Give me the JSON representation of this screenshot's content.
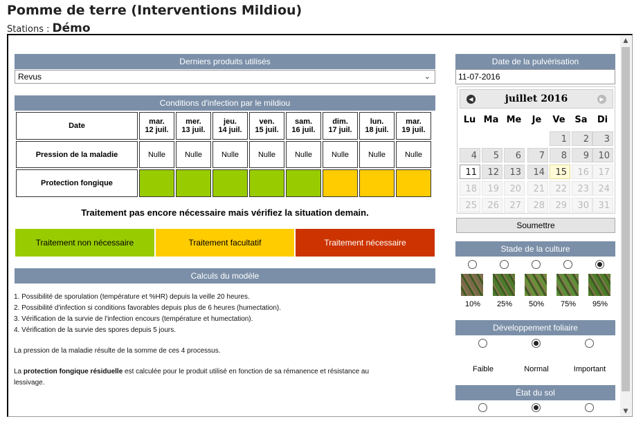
{
  "page": {
    "title": "Pomme de terre (Interventions Mildiou)",
    "stations_label": "Stations :",
    "station_value": "Démo"
  },
  "products": {
    "header": "Derniers produits utilisés",
    "selected": "Revus"
  },
  "conditions": {
    "header": "Conditions d'infection par le mildiou",
    "row_labels": {
      "date": "Date",
      "pressure": "Pression de la maladie",
      "protection": "Protection fongique"
    },
    "days": [
      {
        "dow": "mar.",
        "date": "12 juil.",
        "pressure": "Nulle",
        "protection": "green"
      },
      {
        "dow": "mer.",
        "date": "13 juil.",
        "pressure": "Nulle",
        "protection": "green"
      },
      {
        "dow": "jeu.",
        "date": "14 juil.",
        "pressure": "Nulle",
        "protection": "green"
      },
      {
        "dow": "ven.",
        "date": "15 juil.",
        "pressure": "Nulle",
        "protection": "green"
      },
      {
        "dow": "sam.",
        "date": "16 juil.",
        "pressure": "Nulle",
        "protection": "green"
      },
      {
        "dow": "dim.",
        "date": "17 juil.",
        "pressure": "Nulle",
        "protection": "yellow"
      },
      {
        "dow": "lun.",
        "date": "18 juil.",
        "pressure": "Nulle",
        "protection": "yellow"
      },
      {
        "dow": "mar.",
        "date": "19 juil.",
        "pressure": "Nulle",
        "protection": "yellow"
      }
    ]
  },
  "message": "Traitement pas encore nécessaire mais vérifiez la situation demain.",
  "legend": {
    "green": {
      "label": "Traitement non nécessaire",
      "color": "#99cc00"
    },
    "yellow": {
      "label": "Traitement facultatif",
      "color": "#ffcc00"
    },
    "red": {
      "label": "Traitement nécessaire",
      "color": "#cc3300"
    }
  },
  "model": {
    "header": "Calculs du modèle",
    "lines": [
      "1. Possibilité de sporulation (température et %HR) depuis la veille 20 heures.",
      "2. Possibilité d'infection si conditions favorables depuis plus de 6 heures (humectation).",
      "3. Vérification de la survie de l'infection encours (température et humectation).",
      "4. Vérification de la survie des spores depuis 5 jours."
    ],
    "pressure_note": "La pression de la maladie résulte de la somme de ces 4 processus.",
    "residual_prefix": "La ",
    "residual_bold": "protection fongique résiduelle",
    "residual_rest_1": " est calculée pour le produit utilisé en fonction de sa rémanence et résistance au",
    "residual_rest_2": "lessivage."
  },
  "spray_date": {
    "header": "Date de la pulvérisation",
    "value": "11-07-2016",
    "calendar": {
      "title": "juillet 2016",
      "dow": [
        "Lu",
        "Ma",
        "Me",
        "Je",
        "Ve",
        "Sa",
        "Di"
      ],
      "prev_icon": "prev-month-icon",
      "next_icon": "next-month-icon",
      "weeks": [
        [
          "",
          "",
          "",
          "",
          "1",
          "2",
          "3"
        ],
        [
          "4",
          "5",
          "6",
          "7",
          "8",
          "9",
          "10"
        ],
        [
          "11",
          "12",
          "13",
          "14",
          "15",
          "16",
          "17"
        ],
        [
          "18",
          "19",
          "20",
          "21",
          "22",
          "23",
          "24"
        ],
        [
          "25",
          "26",
          "27",
          "28",
          "29",
          "30",
          "31"
        ]
      ],
      "selected_day": "11",
      "today": "15",
      "last_enabled_day": 15
    },
    "submit_label": "Soumettre"
  },
  "crop_stage": {
    "header": "Stade de la culture",
    "options": [
      "10%",
      "25%",
      "50%",
      "75%",
      "95%"
    ],
    "selected_index": 4
  },
  "foliar": {
    "header": "Développement foliaire",
    "options": [
      "Faible",
      "Normal",
      "Important"
    ],
    "selected_index": 1
  },
  "soil": {
    "header": "État du sol",
    "selected_index": 1
  }
}
